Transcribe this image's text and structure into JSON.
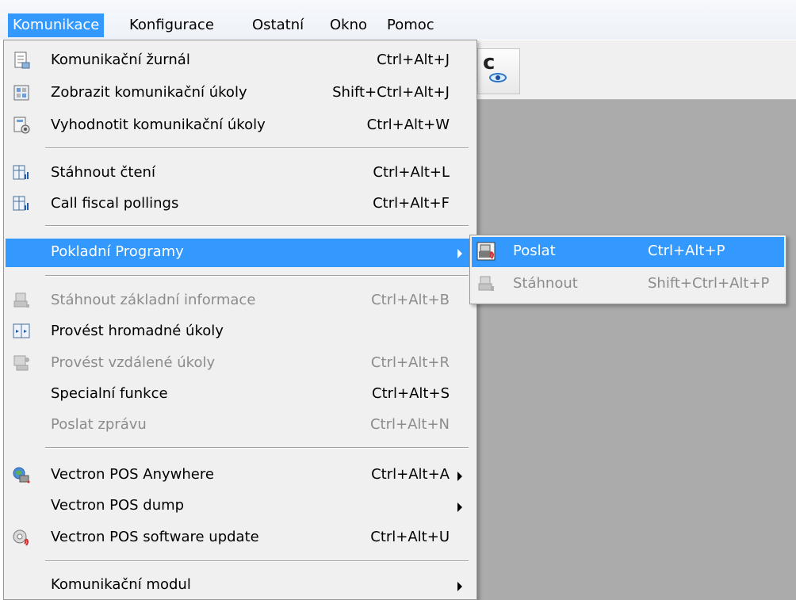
{
  "menubar": {
    "items": [
      "Komunikace",
      "Konfigurace",
      "Ostatní",
      "Okno",
      "Pomoc"
    ]
  },
  "menu": {
    "items": [
      {
        "label": "Komunikační žurnál",
        "shortcut": "Ctrl+Alt+J",
        "icon": "journal-icon"
      },
      {
        "label": "Zobrazit komunikační úkoly",
        "shortcut": "Shift+Ctrl+Alt+J",
        "icon": "tasks-view-icon"
      },
      {
        "label": "Vyhodnotit komunikační úkoly",
        "shortcut": "Ctrl+Alt+W",
        "icon": "tasks-evaluate-icon"
      },
      {
        "label": "Stáhnout čtení",
        "shortcut": "Ctrl+Alt+L",
        "icon": "readings-icon"
      },
      {
        "label": "Call fiscal pollings",
        "shortcut": "Ctrl+Alt+F",
        "icon": "fiscal-icon"
      },
      {
        "label": "Pokladní Programy",
        "shortcut": "",
        "icon": ""
      },
      {
        "label": "Stáhnout základní informace",
        "shortcut": "Ctrl+Alt+B",
        "icon": "basic-info-icon"
      },
      {
        "label": "Provést hromadné úkoly",
        "shortcut": "",
        "icon": "bulk-tasks-icon"
      },
      {
        "label": "Provést vzdálené úkoly",
        "shortcut": "Ctrl+Alt+R",
        "icon": "remote-tasks-icon"
      },
      {
        "label": "Specialní funkce",
        "shortcut": "Ctrl+Alt+S",
        "icon": ""
      },
      {
        "label": "Poslat zprávu",
        "shortcut": "Ctrl+Alt+N",
        "icon": ""
      },
      {
        "label": "Vectron POS Anywhere",
        "shortcut": "Ctrl+Alt+A",
        "icon": "pos-anywhere-icon"
      },
      {
        "label": "Vectron POS dump",
        "shortcut": "",
        "icon": ""
      },
      {
        "label": "Vectron POS software update",
        "shortcut": "Ctrl+Alt+U",
        "icon": "software-update-icon"
      },
      {
        "label": "Komunikační modul",
        "shortcut": "",
        "icon": ""
      }
    ]
  },
  "submenu": {
    "items": [
      {
        "label": "Poslat",
        "shortcut": "Ctrl+Alt+P",
        "icon": "send-program-icon"
      },
      {
        "label": "Stáhnout",
        "shortcut": "Shift+Ctrl+Alt+P",
        "icon": "download-program-icon"
      }
    ]
  },
  "toolbar": {
    "button_letter": "c"
  },
  "colors": {
    "highlight": "#3399ff",
    "menu_bg": "#f0f0f0",
    "disabled_text": "#8c8c8c",
    "workspace": "#ababab"
  }
}
